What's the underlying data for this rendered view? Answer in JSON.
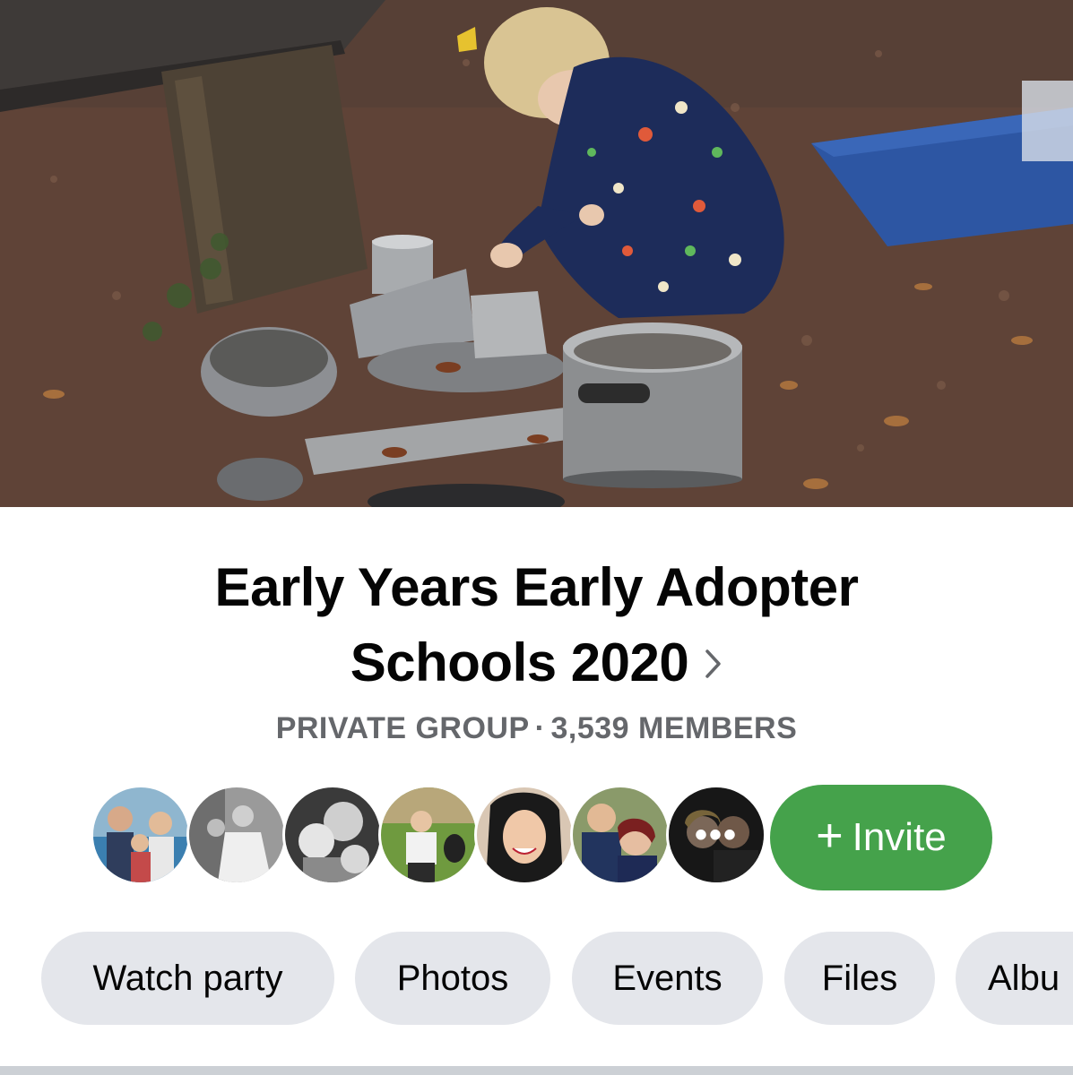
{
  "cover": {
    "image": "outdoor-mud-kitchen-child-with-pots"
  },
  "group": {
    "title_line1": "Early Years Early Adopter",
    "title_line2": "Schools 2020",
    "privacy": "PRIVATE GROUP",
    "separator": "·",
    "members": "3,539 MEMBERS"
  },
  "member_avatars": [
    "member-1",
    "member-2",
    "member-3",
    "member-4",
    "member-5",
    "member-6",
    "member-7"
  ],
  "more_indicator": "•••",
  "invite": {
    "plus": "+",
    "label": "Invite",
    "color": "#45a24b"
  },
  "chips": [
    "Watch party",
    "Photos",
    "Events",
    "Files",
    "Albu"
  ],
  "colors": {
    "chip_bg": "#e4e6eb",
    "meta_text": "#65676b",
    "title_text": "#050505"
  }
}
